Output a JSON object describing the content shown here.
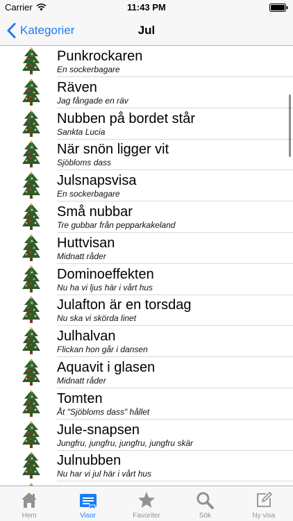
{
  "status_bar": {
    "carrier": "Carrier",
    "time": "11:43 PM"
  },
  "nav": {
    "back_label": "Kategorier",
    "title": "Jul"
  },
  "songs": [
    {
      "title": "Punkrockaren",
      "subtitle": "En sockerbagare"
    },
    {
      "title": "Räven",
      "subtitle": "Jag fångade en räv"
    },
    {
      "title": "Nubben på bordet står",
      "subtitle": "Sankta  Lucia"
    },
    {
      "title": "När snön ligger vit",
      "subtitle": "Sjöbloms dass"
    },
    {
      "title": "Julsnapsvisa",
      "subtitle": "En sockerbagare"
    },
    {
      "title": "Små nubbar",
      "subtitle": "Tre gubbar från pepparkakeland"
    },
    {
      "title": "Huttvisan",
      "subtitle": "Midnatt råder"
    },
    {
      "title": "Dominoeffekten",
      "subtitle": "Nu ha vi ljus här i vårt hus"
    },
    {
      "title": "Julafton är en torsdag",
      "subtitle": "Nu ska vi skörda linet"
    },
    {
      "title": "Julhalvan",
      "subtitle": "Flickan hon går i dansen"
    },
    {
      "title": "Aquavit i glasen",
      "subtitle": "Midnatt råder"
    },
    {
      "title": "Tomten",
      "subtitle": "Åt \"Sjöbloms dass\" hållet"
    },
    {
      "title": "Jule-snapsen",
      "subtitle": "Jungfru, jungfru, jungfru, jungfru skär"
    },
    {
      "title": "Julnubben",
      "subtitle": "Nu har vi jul här i vårt hus"
    }
  ],
  "tabs": [
    {
      "label": "Hem",
      "icon": "house-icon"
    },
    {
      "label": "Visor",
      "icon": "notebook-icon",
      "active": true
    },
    {
      "label": "Favoriter",
      "icon": "star-icon"
    },
    {
      "label": "Sök",
      "icon": "magnifier-icon"
    },
    {
      "label": "Ny visa",
      "icon": "compose-icon"
    }
  ],
  "colors": {
    "accent": "#1a7cf5",
    "inactive": "#929292",
    "bar_bg": "#f7f7f7"
  }
}
